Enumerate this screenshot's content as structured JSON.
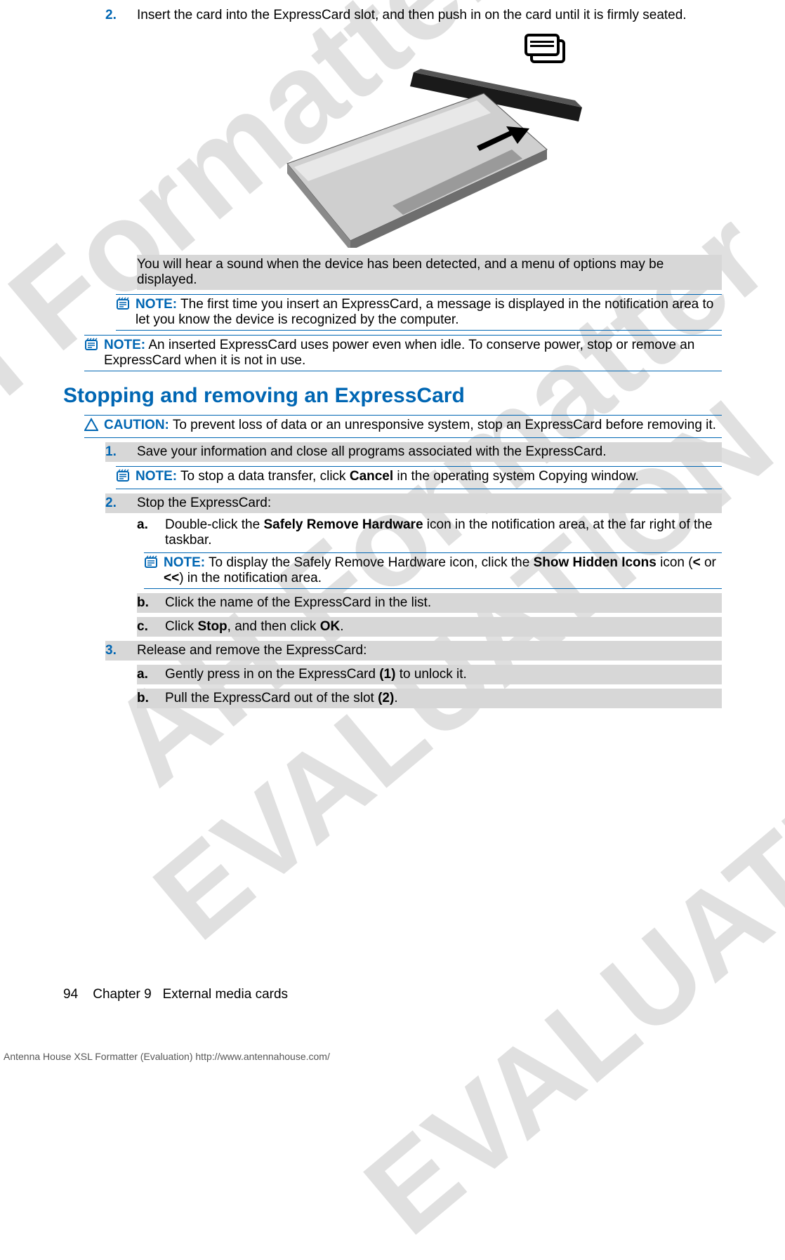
{
  "watermarks": {
    "line1": "AH Formatter",
    "line2": "EVALUATION",
    "line3": "AH Formatter",
    "line4": "EVALUATION"
  },
  "footer": {
    "page": "94",
    "chapter_label": "Chapter 9",
    "chapter_title": "External media cards"
  },
  "formatter_line": "Antenna House XSL Formatter (Evaluation)  http://www.antennahouse.com/",
  "step2": {
    "num": "2.",
    "text": "Insert the card into the ExpressCard slot, and then push in on the card until it is firmly seated.",
    "after": "You will hear a sound when the device has been detected, and a menu of options may be displayed."
  },
  "note1": {
    "label": "NOTE:",
    "text": "The first time you insert an ExpressCard, a message is displayed in the notification area to let you know the device is recognized by the computer."
  },
  "note2": {
    "label": "NOTE:",
    "text": "An inserted ExpressCard uses power even when idle. To conserve power, stop or remove an ExpressCard when it is not in use."
  },
  "heading": "Stopping and removing an ExpressCard",
  "caution": {
    "label": "CAUTION:",
    "text": "To prevent loss of data or an unresponsive system, stop an ExpressCard before removing it."
  },
  "s1": {
    "num": "1.",
    "text": "Save your information and close all programs associated with the ExpressCard."
  },
  "s1note": {
    "label": "NOTE:",
    "text_before": "To stop a data transfer, click ",
    "bold": "Cancel",
    "text_after": " in the operating system Copying window."
  },
  "s2": {
    "num": "2.",
    "text": "Stop the ExpressCard:",
    "a": {
      "num": "a.",
      "before": "Double-click the ",
      "bold": "Safely Remove Hardware",
      "after": " icon in the notification area, at the far right of the taskbar."
    },
    "anote": {
      "label": "NOTE:",
      "before": "To display the Safely Remove Hardware icon, click the ",
      "bold": "Show Hidden Icons",
      "after_pre": " icon (",
      "b1": "<",
      "mid": " or ",
      "b2": "<<",
      "after_post": ") in the notification area."
    },
    "b": {
      "num": "b.",
      "text": "Click the name of the ExpressCard in the list."
    },
    "c": {
      "num": "c.",
      "before": "Click ",
      "bold1": "Stop",
      "mid": ", and then click ",
      "bold2": "OK",
      "after": "."
    }
  },
  "s3": {
    "num": "3.",
    "text": "Release and remove the ExpressCard:",
    "a": {
      "num": "a.",
      "before": "Gently press in on the ExpressCard ",
      "bold": "(1)",
      "after": " to unlock it."
    },
    "b": {
      "num": "b.",
      "before": "Pull the ExpressCard out of the slot ",
      "bold": "(2)",
      "after": "."
    }
  }
}
